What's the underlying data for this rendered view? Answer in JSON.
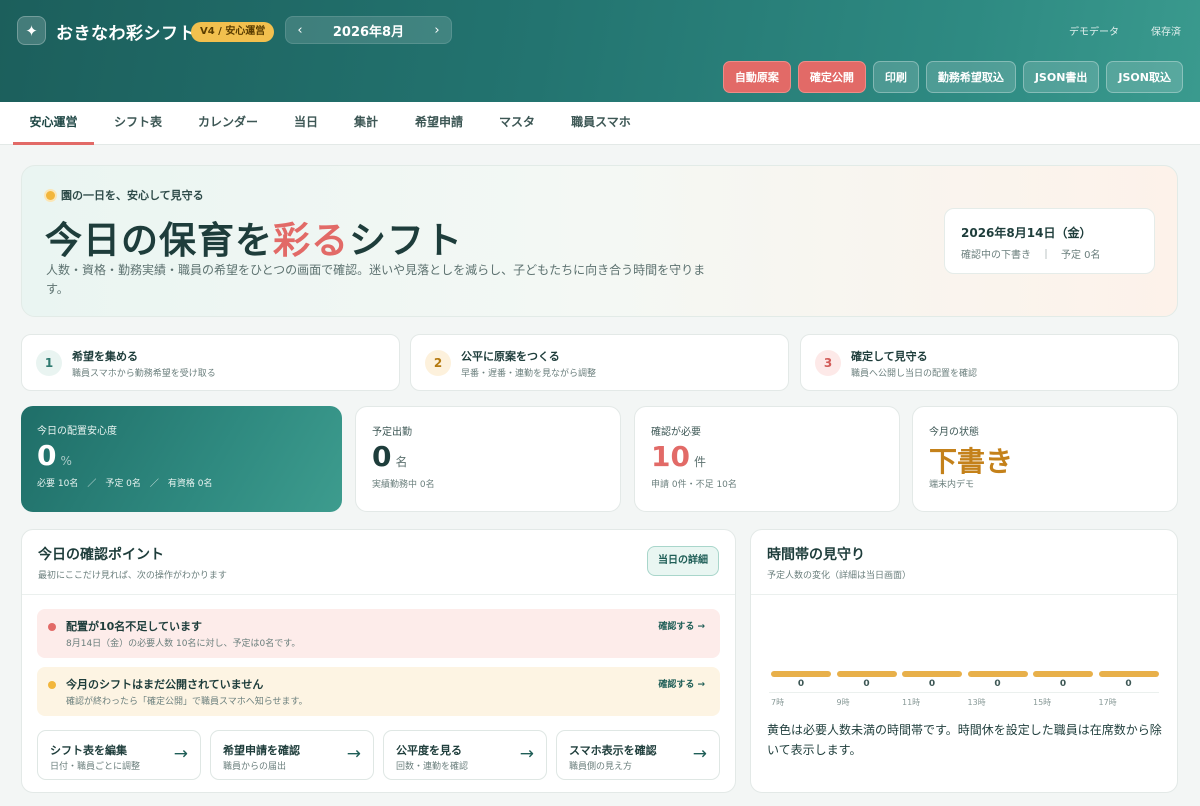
{
  "header": {
    "logo_icon": "✦",
    "title": "おきなわ彩シフト",
    "version_badge": "V4 / 安心運営",
    "month": "2026年8月",
    "prev_arrow": "‹",
    "next_arrow": "›",
    "demo_label": "デモデータ",
    "saved_label": "保存済",
    "actions": [
      "自動原案",
      "確定公開",
      "印刷",
      "勤務希望取込",
      "JSON書出",
      "JSON取込"
    ]
  },
  "tabs": [
    "安心運営",
    "シフト表",
    "カレンダー",
    "当日",
    "集計",
    "希望申請",
    "マスタ",
    "職員スマホ"
  ],
  "hero": {
    "kicker": "園の一日を、安心して見守る",
    "title_pre": "今日の保育を",
    "title_accent": "彩る",
    "title_post": "シフト",
    "desc": "人数・資格・勤務実績・職員の希望をひとつの画面で確認。迷いや見落としを減らし、子どもたちに向き合う時間を守ります。",
    "date": "2026年8月14日（金）",
    "date_sub": "確認中の下書き　｜　予定 0名"
  },
  "steps": [
    {
      "num": "1",
      "title": "希望を集める",
      "sub": "職員スマホから勤務希望を受け取る"
    },
    {
      "num": "2",
      "title": "公平に原案をつくる",
      "sub": "早番・遅番・連勤を見ながら調整"
    },
    {
      "num": "3",
      "title": "確定して見守る",
      "sub": "職員へ公開し当日の配置を確認"
    }
  ],
  "stats": [
    {
      "label": "今日の配置安心度",
      "value": "0",
      "unit": "%",
      "foot": "必要 10名　／　予定 0名　／　有資格 0名"
    },
    {
      "label": "予定出勤",
      "value": "0",
      "unit": "名",
      "foot": "実績勤務中 0名"
    },
    {
      "label": "確認が必要",
      "value": "10",
      "unit": "件",
      "foot": "申請 0件・不足 10名"
    },
    {
      "label": "今月の状態",
      "value": "下書き",
      "unit": "",
      "foot": "端末内デモ"
    }
  ],
  "check_panel": {
    "title": "今日の確認ポイント",
    "sub": "最初にここだけ見れば、次の操作がわかります",
    "detail_button": "当日の詳細",
    "alerts": [
      {
        "title": "配置が10名不足しています",
        "sub": "8月14日（金）の必要人数 10名に対し、予定は0名です。",
        "link": "確認する →"
      },
      {
        "title": "今月のシフトはまだ公開されていません",
        "sub": "確認が終わったら「確定公開」で職員スマホへ知らせます。",
        "link": "確認する →"
      }
    ],
    "quick": [
      {
        "title": "シフト表を編集",
        "sub": "日付・職員ごとに調整",
        "arrow": "→"
      },
      {
        "title": "希望申請を確認",
        "sub": "職員からの届出",
        "arrow": "→"
      },
      {
        "title": "公平度を見る",
        "sub": "回数・連勤を確認",
        "arrow": "→"
      },
      {
        "title": "スマホ表示を確認",
        "sub": "職員側の見え方",
        "arrow": "→"
      }
    ]
  },
  "time_panel": {
    "title": "時間帯の見守り",
    "sub": "予定人数の変化（詳細は当日画面）",
    "note": "黄色は必要人数未満の時間帯です。時間休を設定した職員は在席数から除いて表示します。"
  },
  "chart_data": {
    "type": "bar",
    "categories": [
      "7時",
      "9時",
      "11時",
      "13時",
      "15時",
      "17時"
    ],
    "bar_labels": [
      "0",
      "0",
      "0",
      "0",
      "0",
      "0"
    ],
    "values": [
      0,
      0,
      0,
      0,
      0,
      0
    ],
    "bar_color": "#e8b04a"
  },
  "colors": {
    "accent": "#e26a67",
    "brand": "#237470",
    "warning": "#f2b63c",
    "draft": "#c4811a"
  }
}
